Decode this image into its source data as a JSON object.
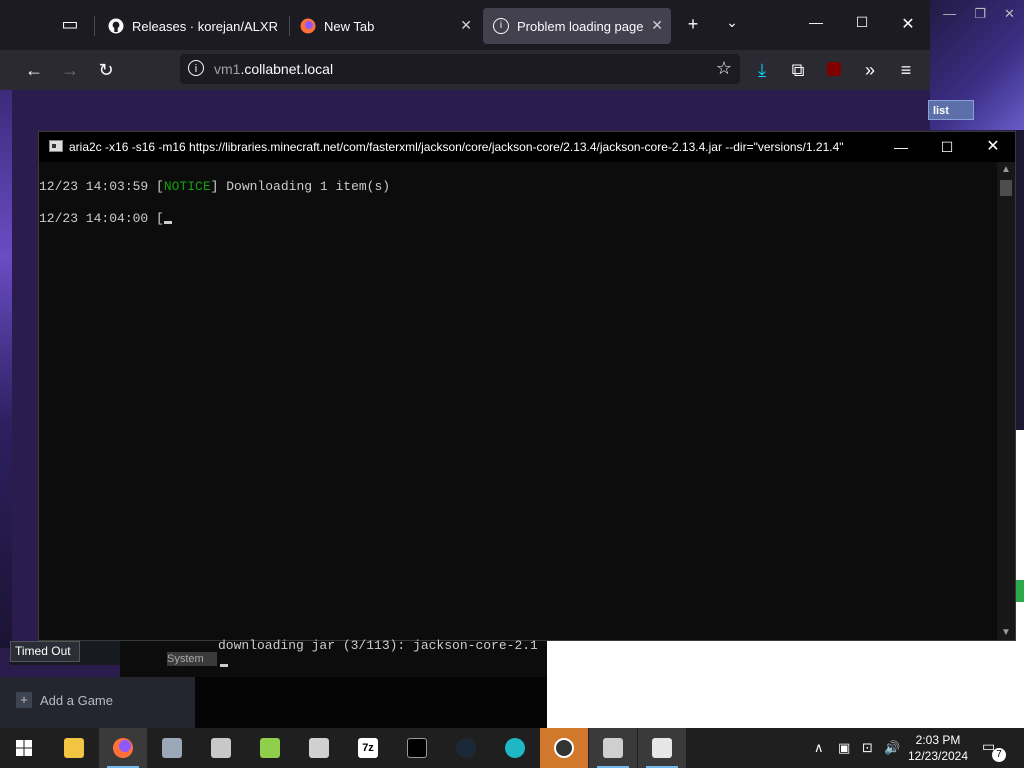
{
  "browser": {
    "tabs": [
      {
        "label": "Releases · korejan/ALXR-",
        "icon": "github-icon"
      },
      {
        "label": "New Tab",
        "icon": "firefox-icon"
      },
      {
        "label": "Problem loading page",
        "icon": "info-icon"
      }
    ],
    "url_dim": "vm1",
    "url_main": ".collabnet.local",
    "accent_active_tab": "#42414d"
  },
  "desktop": {
    "list_button": "list"
  },
  "console": {
    "title": "aria2c  -x16 -s16 -m16 https://libraries.minecraft.net/com/fasterxml/jackson/core/jackson-core/2.13.4/jackson-core-2.13.4.jar --dir=\"versions/1.21.4\"",
    "line1_time": "12/23 14:03:59 [",
    "line1_notice": "NOTICE",
    "line1_rest": "] Downloading 1 item(s)",
    "line2": "12/23 14:04:00 [",
    "notice_color": "#13a10e"
  },
  "behind": {
    "timed_out": "Timed Out",
    "console_text": "downloading jar (3/113): jackson-core-2.1",
    "label": "System",
    "add_game": "Add a Game"
  },
  "taskbar": {
    "time": "2:03 PM",
    "date": "12/23/2024",
    "notification_count": "7"
  }
}
